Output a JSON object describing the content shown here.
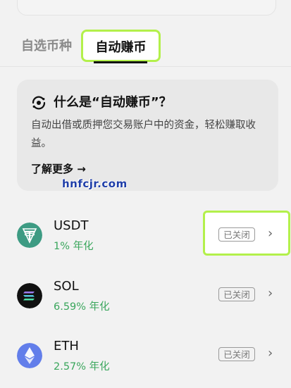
{
  "tabs": {
    "watchlist": "自选币种",
    "auto_earn": "自动赚币"
  },
  "info_card": {
    "title": "什么是“自动赚币”？",
    "description": "自动出借或质押您交易账户中的资金，轻松赚取收益。",
    "learn_more": "了解更多 →"
  },
  "watermark": "hnfcjr.com",
  "coins": [
    {
      "name": "USDT",
      "apy": "1% 年化",
      "status": "已关闭",
      "color": "#3d9b83"
    },
    {
      "name": "SOL",
      "apy": "6.59% 年化",
      "status": "已关闭",
      "color": "#111111"
    },
    {
      "name": "ETH",
      "apy": "2.57% 年化",
      "status": "已关闭",
      "color": "#627eea"
    }
  ],
  "colors": {
    "accent_highlight": "#b3f04b",
    "positive": "#3aa65c"
  }
}
